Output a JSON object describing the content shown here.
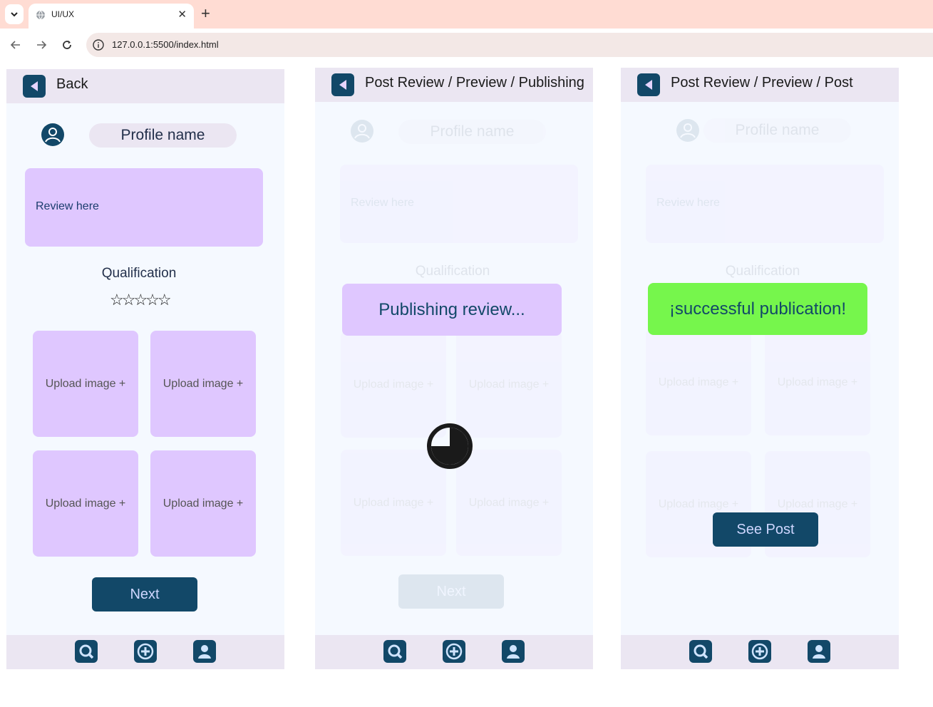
{
  "browser": {
    "tab_title": "UI/UX",
    "url": "127.0.0.1:5500/index.html"
  },
  "screens": [
    {
      "header_title": "Back",
      "profile_name": "Profile name",
      "review_placeholder": "Review here",
      "qualification_label": "Qualification",
      "stars": "☆☆☆☆☆",
      "upload_labels": [
        "Upload image +",
        "Upload image +",
        "Upload image +",
        "Upload image +"
      ],
      "next_label": "Next"
    },
    {
      "header_title": "Post Review / Preview / Publishing",
      "profile_name": "Profile name",
      "review_placeholder": "Review here",
      "qualification_label": "Qualification",
      "upload_labels": [
        "Upload image +",
        "Upload image +",
        "Upload image +",
        "Upload image +"
      ],
      "next_label": "Next",
      "popup_text": "Publishing review..."
    },
    {
      "header_title": "Post Review / Preview / Post",
      "profile_name": "Profile name",
      "review_placeholder": "Review here",
      "qualification_label": "Qualification",
      "upload_labels": [
        "Upload image +",
        "Upload image +",
        "Upload image +",
        "Upload image +"
      ],
      "popup_text": "¡successful publication!",
      "see_post_label": "See Post"
    }
  ],
  "colors": {
    "primary": "#124868",
    "lavender": "#dfc7ff",
    "success": "#76f64c",
    "header_bg": "#ebe6f2"
  },
  "footer_icons": [
    "search-icon",
    "add-circle-icon",
    "profile-icon"
  ]
}
